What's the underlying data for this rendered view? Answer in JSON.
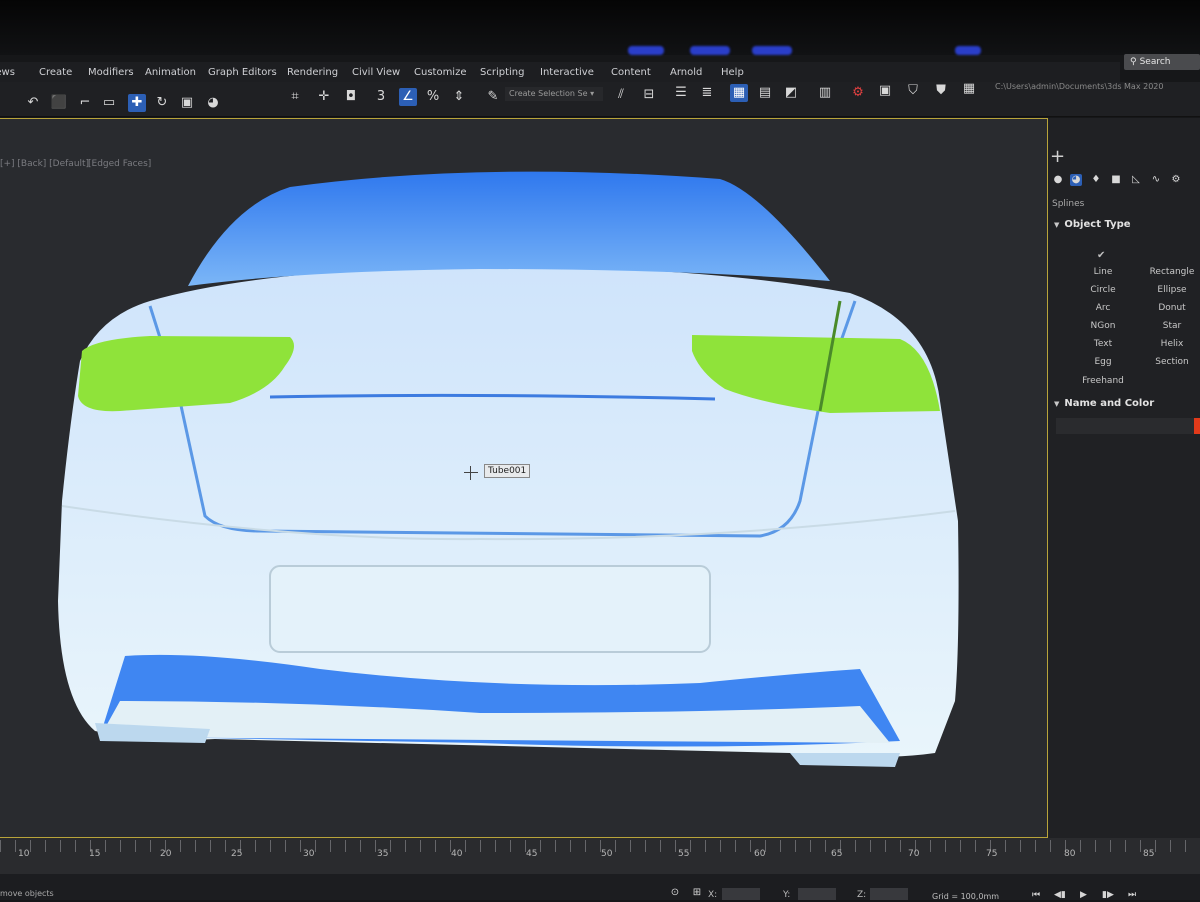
{
  "app": {
    "search_placeholder": "Search",
    "file_path": "C:\\Users\\admin\\Documents\\3ds Max 2020"
  },
  "menu": {
    "items": [
      "Views",
      "Create",
      "Modifiers",
      "Animation",
      "Graph Editors",
      "Rendering",
      "Civil View",
      "Customize",
      "Scripting",
      "Interactive",
      "Content",
      "Arnold",
      "Help"
    ]
  },
  "toolbar": {
    "selection_set_placeholder": "Create Selection Se",
    "icons": [
      "undo-icon",
      "redo-icon",
      "link-icon",
      "unlink-icon",
      "bind-icon",
      "select-icon",
      "select-by-name-icon",
      "region-select-icon",
      "move-icon",
      "rotate-icon",
      "scale-icon",
      "place-icon",
      "ref-coord-icon",
      "pivot-icon",
      "snap-3d-icon",
      "angle-snap-icon",
      "percent-snap-icon",
      "spinner-snap-icon",
      "edit-named-sets-icon",
      "mirror-icon",
      "align-icon",
      "scene-explorer-icon",
      "layer-explorer-icon",
      "ribbon-icon",
      "curve-editor-icon",
      "schematic-icon",
      "material-editor-icon",
      "render-setup-icon",
      "frame-window-icon",
      "render-icon",
      "render-iterative-icon",
      "arnold-icon"
    ]
  },
  "viewport": {
    "label_view": "[+] [Back] [Default]",
    "label_shading": "[Edged Faces]",
    "tooltip": "Tube001",
    "body_color": "#dcefff",
    "glass_color": "#3f86f2",
    "light_color": "#8fe33a"
  },
  "command_panel": {
    "category": "Splines",
    "object_type_title": "Object Type",
    "autogrid_label": "✔",
    "buttons": [
      [
        "Line",
        "Rectangle"
      ],
      [
        "Circle",
        "Ellipse"
      ],
      [
        "Arc",
        "Donut"
      ],
      [
        "NGon",
        "Star"
      ],
      [
        "Text",
        "Helix"
      ],
      [
        "Egg",
        "Section"
      ],
      [
        "Freehand",
        ""
      ]
    ],
    "name_color_title": "Name and Color",
    "swatch_color": "#e23a1a"
  },
  "timeline": {
    "ticks": [
      "10",
      "15",
      "20",
      "25",
      "30",
      "35",
      "40",
      "45",
      "50",
      "55",
      "60",
      "65",
      "70",
      "75",
      "80",
      "85"
    ]
  },
  "status": {
    "message": "move objects",
    "x_label": "X:",
    "y_label": "Y:",
    "z_label": "Z:",
    "grid": "Grid = 100,0mm"
  }
}
